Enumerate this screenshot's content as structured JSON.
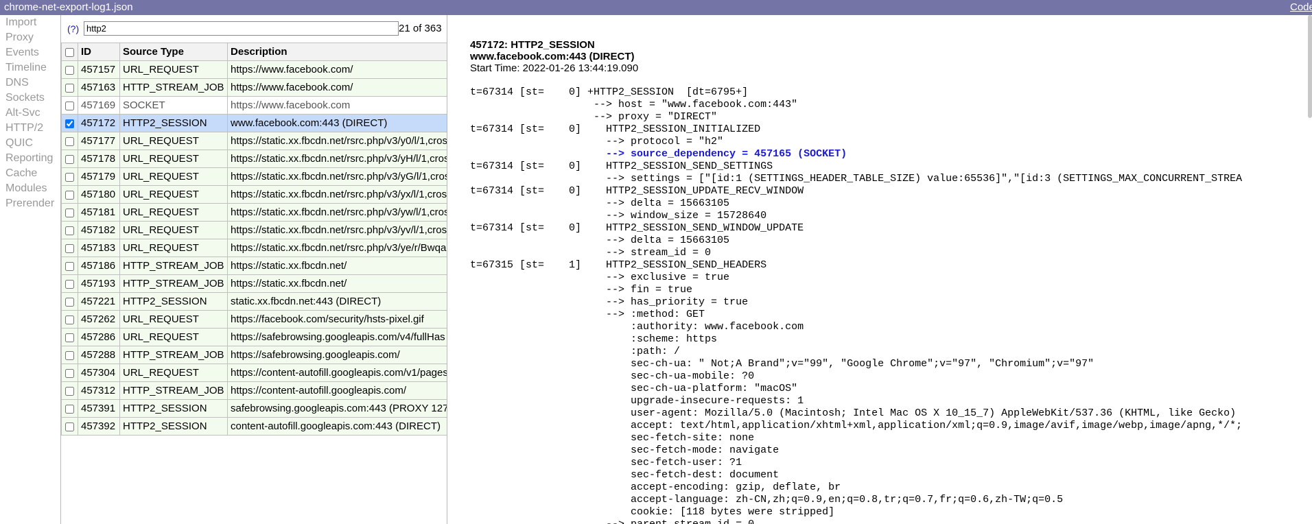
{
  "window": {
    "title": "chrome-net-export-log1.json",
    "corner_link": "Code"
  },
  "nav": {
    "items": [
      "Import",
      "Proxy",
      "Events",
      "Timeline",
      "DNS",
      "Sockets",
      "Alt-Svc",
      "HTTP/2",
      "QUIC",
      "Reporting",
      "Cache",
      "Modules",
      "Prerender"
    ]
  },
  "filter": {
    "help": "(?)",
    "value": "http2",
    "count": "21 of 363"
  },
  "table": {
    "columns": [
      "ID",
      "Source Type",
      "Description"
    ],
    "rows": [
      {
        "id": "457157",
        "type": "URL_REQUEST",
        "desc": "https://www.facebook.com/",
        "checked": false
      },
      {
        "id": "457163",
        "type": "HTTP_STREAM_JOB",
        "desc": "https://www.facebook.com/",
        "checked": false
      },
      {
        "id": "457169",
        "type": "SOCKET",
        "desc": "https://www.facebook.com",
        "checked": false
      },
      {
        "id": "457172",
        "type": "HTTP2_SESSION",
        "desc": "www.facebook.com:443 (DIRECT)",
        "checked": true
      },
      {
        "id": "457177",
        "type": "URL_REQUEST",
        "desc": "https://static.xx.fbcdn.net/rsrc.php/v3/y0/l/1,cross",
        "checked": false
      },
      {
        "id": "457178",
        "type": "URL_REQUEST",
        "desc": "https://static.xx.fbcdn.net/rsrc.php/v3/yH/l/1,cross",
        "checked": false
      },
      {
        "id": "457179",
        "type": "URL_REQUEST",
        "desc": "https://static.xx.fbcdn.net/rsrc.php/v3/yG/l/1,cross",
        "checked": false
      },
      {
        "id": "457180",
        "type": "URL_REQUEST",
        "desc": "https://static.xx.fbcdn.net/rsrc.php/v3/yx/l/1,cross",
        "checked": false
      },
      {
        "id": "457181",
        "type": "URL_REQUEST",
        "desc": "https://static.xx.fbcdn.net/rsrc.php/v3/yw/l/1,cross",
        "checked": false
      },
      {
        "id": "457182",
        "type": "URL_REQUEST",
        "desc": "https://static.xx.fbcdn.net/rsrc.php/v3/yv/l/1,cross",
        "checked": false
      },
      {
        "id": "457183",
        "type": "URL_REQUEST",
        "desc": "https://static.xx.fbcdn.net/rsrc.php/v3/ye/r/Bwqa",
        "checked": false
      },
      {
        "id": "457186",
        "type": "HTTP_STREAM_JOB",
        "desc": "https://static.xx.fbcdn.net/",
        "checked": false
      },
      {
        "id": "457193",
        "type": "HTTP_STREAM_JOB",
        "desc": "https://static.xx.fbcdn.net/",
        "checked": false
      },
      {
        "id": "457221",
        "type": "HTTP2_SESSION",
        "desc": "static.xx.fbcdn.net:443 (DIRECT)",
        "checked": false
      },
      {
        "id": "457262",
        "type": "URL_REQUEST",
        "desc": "https://facebook.com/security/hsts-pixel.gif",
        "checked": false
      },
      {
        "id": "457286",
        "type": "URL_REQUEST",
        "desc": "https://safebrowsing.googleapis.com/v4/fullHas",
        "checked": false
      },
      {
        "id": "457288",
        "type": "HTTP_STREAM_JOB",
        "desc": "https://safebrowsing.googleapis.com/",
        "checked": false
      },
      {
        "id": "457304",
        "type": "URL_REQUEST",
        "desc": "https://content-autofill.googleapis.com/v1/pages",
        "checked": false
      },
      {
        "id": "457312",
        "type": "HTTP_STREAM_JOB",
        "desc": "https://content-autofill.googleapis.com/",
        "checked": false
      },
      {
        "id": "457391",
        "type": "HTTP2_SESSION",
        "desc": "safebrowsing.googleapis.com:443 (PROXY 127",
        "checked": false
      },
      {
        "id": "457392",
        "type": "HTTP2_SESSION",
        "desc": "content-autofill.googleapis.com:443 (DIRECT)",
        "checked": false
      }
    ]
  },
  "details": {
    "heading": "457172: HTTP2_SESSION",
    "subheading": "www.facebook.com:443 (DIRECT)",
    "start_time": "Start Time: 2022-01-26 13:44:19.090",
    "log": [
      "t=67314 [st=    0] +HTTP2_SESSION  [dt=6795+]",
      "                    --> host = \"www.facebook.com:443\"",
      "                    --> proxy = \"DIRECT\"",
      "t=67314 [st=    0]    HTTP2_SESSION_INITIALIZED",
      "                      --> protocol = \"h2\"",
      "                      --> source_dependency = 457165 (SOCKET)",
      "t=67314 [st=    0]    HTTP2_SESSION_SEND_SETTINGS",
      "                      --> settings = [\"[id:1 (SETTINGS_HEADER_TABLE_SIZE) value:65536]\",\"[id:3 (SETTINGS_MAX_CONCURRENT_STREA",
      "t=67314 [st=    0]    HTTP2_SESSION_UPDATE_RECV_WINDOW",
      "                      --> delta = 15663105",
      "                      --> window_size = 15728640",
      "t=67314 [st=    0]    HTTP2_SESSION_SEND_WINDOW_UPDATE",
      "                      --> delta = 15663105",
      "                      --> stream_id = 0",
      "t=67315 [st=    1]    HTTP2_SESSION_SEND_HEADERS",
      "                      --> exclusive = true",
      "                      --> fin = true",
      "                      --> has_priority = true",
      "                      --> :method: GET",
      "                          :authority: www.facebook.com",
      "                          :scheme: https",
      "                          :path: /",
      "                          sec-ch-ua: \" Not;A Brand\";v=\"99\", \"Google Chrome\";v=\"97\", \"Chromium\";v=\"97\"",
      "                          sec-ch-ua-mobile: ?0",
      "                          sec-ch-ua-platform: \"macOS\"",
      "                          upgrade-insecure-requests: 1",
      "                          user-agent: Mozilla/5.0 (Macintosh; Intel Mac OS X 10_15_7) AppleWebKit/537.36 (KHTML, like Gecko)",
      "                          accept: text/html,application/xhtml+xml,application/xml;q=0.9,image/avif,image/webp,image/apng,*/*;",
      "                          sec-fetch-site: none",
      "                          sec-fetch-mode: navigate",
      "                          sec-fetch-user: ?1",
      "                          sec-fetch-dest: document",
      "                          accept-encoding: gzip, deflate, br",
      "                          accept-language: zh-CN,zh;q=0.9,en;q=0.8,tr;q=0.7,fr;q=0.6,zh-TW;q=0.5",
      "                          cookie: [118 bytes were stripped]",
      "                      --> parent_stream_id = 0"
    ],
    "highlight_line": 5
  },
  "colors": {
    "topbar": "#7474a6",
    "selected_row": "#c6dbf9",
    "row_tint": "#f3fbef",
    "highlight_text": "#1a1acf"
  }
}
